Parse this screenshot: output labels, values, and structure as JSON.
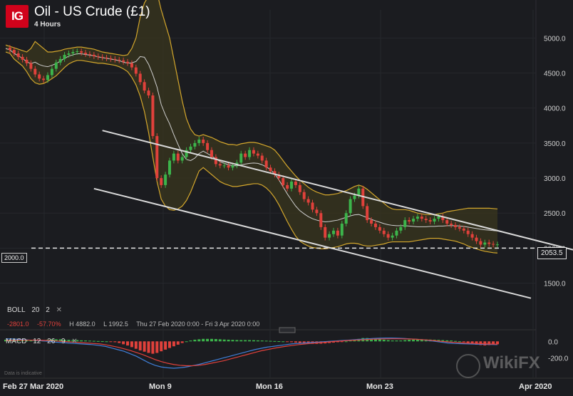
{
  "header": {
    "logo_text": "IG",
    "title": "Oil - US Crude (£1)",
    "subtitle": "4 Hours"
  },
  "indicators": {
    "boll": {
      "name": "BOLL",
      "period": "20",
      "dev": "2",
      "close": "✕"
    },
    "stats": {
      "change": "-2801.0",
      "change_pct": "-57.70%",
      "high": "H 4882.0",
      "low": "L 1992.5",
      "range": "Thu 27 Feb 2020 0:00 - Fri 3 Apr 2020 0:00"
    },
    "macd": {
      "name": "MACD",
      "fast": "12",
      "slow": "26",
      "signal": "9",
      "close": "✕"
    }
  },
  "footer": {
    "disclaimer": "Data is indicative",
    "watermark": "WikiFX"
  },
  "tags": {
    "current_price": "2053.5",
    "level": "2000.0"
  },
  "colors": {
    "background": "#1b1c20",
    "up": "#3cb44b",
    "down": "#e0413b",
    "band": "#d4a72c",
    "band_fill": "#3a351e",
    "mid": "#cfcfcf",
    "channel": "#d9d9d9",
    "macd_line": "#3f7fd8",
    "signal_line": "#e0413b"
  },
  "chart_data": [
    {
      "type": "candlestick",
      "title": "Oil - US Crude (£1)",
      "subtitle": "4 Hours",
      "xlabel": "",
      "ylabel": "",
      "x_ticks": [
        "Feb 27",
        "Mar 2020",
        "Mon 9",
        "Mon 16",
        "Mon 23",
        "Apr 2020"
      ],
      "y_ticks": [
        1500.0,
        2000.0,
        2500.0,
        3000.0,
        3500.0,
        4000.0,
        4500.0,
        5000.0
      ],
      "ylim": [
        1150,
        5400
      ],
      "grid": true,
      "horizontal_line": 2000.0,
      "last_price": 2053.5,
      "closes": [
        4860,
        4830,
        4780,
        4730,
        4690,
        4640,
        4560,
        4480,
        4420,
        4400,
        4470,
        4560,
        4650,
        4700,
        4760,
        4780,
        4800,
        4810,
        4790,
        4770,
        4760,
        4740,
        4730,
        4720,
        4710,
        4700,
        4690,
        4680,
        4660,
        4640,
        4580,
        4490,
        4370,
        4250,
        4180,
        3600,
        3000,
        2900,
        3050,
        3250,
        3350,
        3250,
        3300,
        3400,
        3450,
        3500,
        3550,
        3500,
        3400,
        3300,
        3200,
        3180,
        3180,
        3150,
        3180,
        3220,
        3350,
        3300,
        3400,
        3350,
        3320,
        3250,
        3150,
        3100,
        3050,
        3000,
        2900,
        2850,
        2950,
        2900,
        2800,
        2700,
        2650,
        2550,
        2500,
        2300,
        2150,
        2200,
        2250,
        2180,
        2350,
        2500,
        2700,
        2750,
        2850,
        2600,
        2400,
        2350,
        2300,
        2250,
        2200,
        2150,
        2180,
        2250,
        2300,
        2400,
        2380,
        2420,
        2450,
        2420,
        2400,
        2380,
        2420,
        2450,
        2400,
        2350,
        2330,
        2300,
        2280,
        2250,
        2200,
        2150,
        2100,
        2050,
        2080,
        2060,
        2050,
        2053.5
      ],
      "bands_upper": [
        4900,
        4880,
        4860,
        4840,
        4820,
        4800,
        4850,
        4950,
        4900,
        4850,
        4800,
        4800,
        4810,
        4820,
        4840,
        4850,
        4860,
        4870,
        4870,
        4860,
        4850,
        4840,
        4820,
        4800,
        4790,
        4780,
        4770,
        4760,
        4750,
        4760,
        4850,
        5000,
        5300,
        5500,
        5600,
        5650,
        5650,
        5400,
        5200,
        5000,
        4700,
        4400,
        4100,
        3850,
        3700,
        3620,
        3600,
        3620,
        3600,
        3580,
        3550,
        3520,
        3500,
        3480,
        3480,
        3470,
        3490,
        3500,
        3510,
        3510,
        3500,
        3480,
        3460,
        3440,
        3400,
        3330,
        3250,
        3170,
        3100,
        3030,
        2970,
        2920,
        2870,
        2830,
        2800,
        2780,
        2760,
        2760,
        2770,
        2780,
        2800,
        2820,
        2850,
        2880,
        2900,
        2880,
        2840,
        2790,
        2740,
        2690,
        2640,
        2590,
        2560,
        2550,
        2550,
        2550,
        2540,
        2520,
        2500,
        2490,
        2480,
        2480,
        2480,
        2490,
        2500,
        2520,
        2530,
        2540,
        2550,
        2560,
        2570,
        2570,
        2570,
        2570,
        2570,
        2570,
        2565,
        2560
      ],
      "bands_lower": [
        4800,
        4780,
        4700,
        4650,
        4600,
        4520,
        4420,
        4360,
        4340,
        4350,
        4380,
        4420,
        4460,
        4520,
        4580,
        4630,
        4660,
        4680,
        4680,
        4670,
        4660,
        4650,
        4640,
        4640,
        4630,
        4620,
        4610,
        4590,
        4560,
        4520,
        4440,
        4330,
        4170,
        3950,
        3650,
        3300,
        2950,
        2700,
        2600,
        2550,
        2540,
        2560,
        2600,
        2680,
        2800,
        2950,
        3100,
        3150,
        3100,
        3050,
        3000,
        2950,
        2920,
        2900,
        2880,
        2880,
        2890,
        2900,
        2910,
        2920,
        2920,
        2900,
        2860,
        2800,
        2720,
        2620,
        2500,
        2380,
        2270,
        2170,
        2100,
        2060,
        2030,
        2010,
        2000,
        1990,
        1990,
        2000,
        2010,
        2020,
        2040,
        2060,
        2070,
        2070,
        2060,
        2040,
        2030,
        2030,
        2040,
        2050,
        2060,
        2080,
        2090,
        2090,
        2090,
        2090,
        2090,
        2100,
        2110,
        2120,
        2130,
        2140,
        2140,
        2140,
        2130,
        2120,
        2110,
        2100,
        2080,
        2060,
        2030,
        2010,
        1990,
        1970,
        1955,
        1945,
        1935,
        1930
      ],
      "channel_upper": {
        "start": [
          3680,
          23
        ],
        "end": [
          2250,
          117
        ]
      },
      "channel_lower": {
        "start": [
          2850,
          21
        ],
        "end": [
          1390,
          118
        ]
      }
    },
    {
      "type": "macd",
      "y_ticks": [
        0.0,
        -200.0
      ],
      "ylim": [
        -420,
        80
      ],
      "histogram": [
        20,
        20,
        25,
        30,
        25,
        20,
        15,
        10,
        10,
        15,
        20,
        25,
        25,
        25,
        20,
        18,
        15,
        15,
        12,
        10,
        8,
        6,
        4,
        2,
        0,
        -5,
        -10,
        -20,
        -35,
        -50,
        -70,
        -90,
        -110,
        -125,
        -140,
        -150,
        -140,
        -120,
        -100,
        -80,
        -60,
        -40,
        -20,
        0,
        10,
        20,
        25,
        30,
        30,
        30,
        28,
        25,
        22,
        20,
        18,
        16,
        15,
        15,
        15,
        14,
        12,
        10,
        8,
        6,
        4,
        2,
        0,
        -5,
        -10,
        -15,
        -20,
        -25,
        -30,
        -30,
        -30,
        -28,
        -25,
        -20,
        -15,
        -10,
        -5,
        0,
        10,
        20,
        30,
        40,
        40,
        35,
        30,
        25,
        20,
        15,
        10,
        10,
        10,
        15,
        20,
        22,
        24,
        25,
        24,
        22,
        20,
        18,
        15,
        12,
        10,
        5,
        0,
        -10,
        -20,
        -30,
        -40,
        -45,
        -50,
        -45,
        -40,
        -35
      ],
      "macd": [
        30,
        30,
        25,
        20,
        15,
        10,
        5,
        0,
        -10,
        -15,
        -20,
        -25,
        -30,
        -35,
        -40,
        -50,
        -60,
        -80,
        -100,
        -120,
        -150,
        -180,
        -220,
        -260,
        -290,
        -310,
        -320,
        -325,
        -320,
        -310,
        -295,
        -280,
        -260,
        -240,
        -220,
        -200,
        -180,
        -160,
        -140,
        -120,
        -100,
        -85,
        -70,
        -60,
        -50,
        -40,
        -30,
        -25,
        -20,
        -15,
        -10,
        -5,
        0,
        5,
        10,
        15,
        20,
        25,
        30,
        35,
        38,
        40,
        40,
        38,
        35,
        30,
        25,
        20,
        10,
        0,
        -10,
        -20,
        -25,
        -28,
        -30,
        -32,
        -34,
        -36,
        -38,
        -40
      ],
      "signal": [
        10,
        12,
        14,
        15,
        15,
        14,
        12,
        10,
        5,
        0,
        -5,
        -10,
        -15,
        -20,
        -25,
        -30,
        -40,
        -55,
        -70,
        -90,
        -110,
        -135,
        -160,
        -190,
        -220,
        -245,
        -265,
        -280,
        -290,
        -295,
        -295,
        -290,
        -280,
        -265,
        -250,
        -235,
        -215,
        -195,
        -175,
        -155,
        -135,
        -115,
        -100,
        -85,
        -72,
        -60,
        -50,
        -40,
        -32,
        -25,
        -18,
        -12,
        -6,
        0,
        5,
        10,
        14,
        18,
        22,
        26,
        28,
        30,
        31,
        31,
        30,
        28,
        25,
        20,
        15,
        8,
        0,
        -6,
        -12,
        -17,
        -21,
        -24,
        -27,
        -30,
        -32,
        -34
      ]
    }
  ]
}
